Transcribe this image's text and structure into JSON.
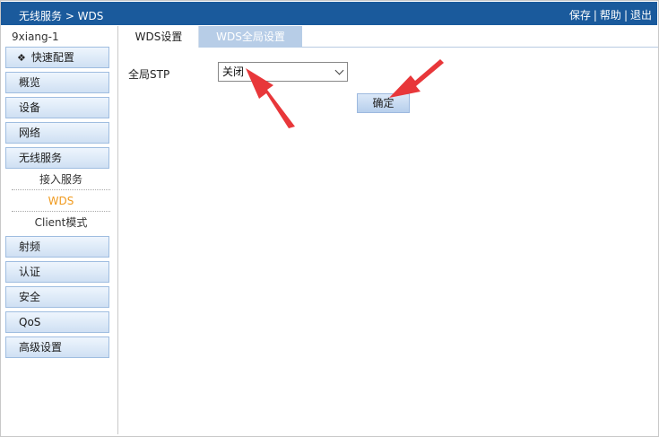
{
  "header": {
    "breadcrumb": "无线服务 > WDS",
    "links": {
      "save": "保存",
      "help": "帮助",
      "logout": "退出",
      "separator": "|"
    }
  },
  "sidebar": {
    "device_name": "9xiang-1",
    "quick_config": {
      "icon": "diamond-icon",
      "label": "快速配置"
    },
    "menu": [
      {
        "label": "概览"
      },
      {
        "label": "设备"
      },
      {
        "label": "网络"
      },
      {
        "label": "无线服务"
      }
    ],
    "submenu": [
      {
        "label": "接入服务",
        "active": false
      },
      {
        "label": "WDS",
        "active": true
      },
      {
        "label": "Client模式",
        "active": false
      }
    ],
    "menu_after": [
      {
        "label": "射频"
      },
      {
        "label": "认证"
      },
      {
        "label": "安全"
      },
      {
        "label": "QoS"
      },
      {
        "label": "高级设置"
      }
    ]
  },
  "tabs": [
    {
      "label": "WDS设置",
      "selected": false
    },
    {
      "label": "WDS全局设置",
      "selected": true
    }
  ],
  "form": {
    "stp_label": "全局STP",
    "stp_value": "关闭",
    "confirm_label": "确定"
  },
  "colors": {
    "topbar": "#1a5a9c",
    "active_subitem": "#f09a1e",
    "annotation_arrow": "#e8373a"
  }
}
